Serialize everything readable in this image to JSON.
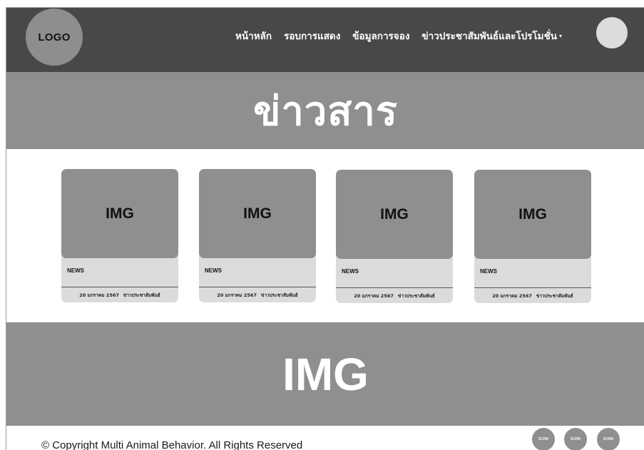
{
  "header": {
    "logo": "LOGO",
    "nav": [
      {
        "label": "หน้าหลัก"
      },
      {
        "label": "รอบการแสดง"
      },
      {
        "label": "ข้อมูลการจอง"
      },
      {
        "label": "ข่าวประชาสัมพันธ์และโปรโมชั่น",
        "caret": "▾"
      }
    ]
  },
  "hero": {
    "title": "ข่าวสาร"
  },
  "news": [
    {
      "image": "IMG",
      "category": "NEWS",
      "date": "20 มกราคม 2567",
      "tag": "ข่าวประชาสัมพันธ์"
    },
    {
      "image": "IMG",
      "category": "NEWS",
      "date": "20 มกราคม 2567",
      "tag": "ข่าวประชาสัมพันธ์"
    },
    {
      "image": "IMG",
      "category": "NEWS",
      "date": "20 มกราคม 2567",
      "tag": "ข่าวประชาสัมพันธ์"
    },
    {
      "image": "IMG",
      "category": "NEWS",
      "date": "20 มกราคม 2567",
      "tag": "ข่าวประชาสัมพันธ์"
    }
  ],
  "banner": {
    "text": "IMG"
  },
  "footer": {
    "copyright": "© Copyright Multi Animal Behavior. All Rights Reserved",
    "social": [
      {
        "label": "ICON"
      },
      {
        "label": "ICON"
      },
      {
        "label": "ICON"
      }
    ]
  }
}
